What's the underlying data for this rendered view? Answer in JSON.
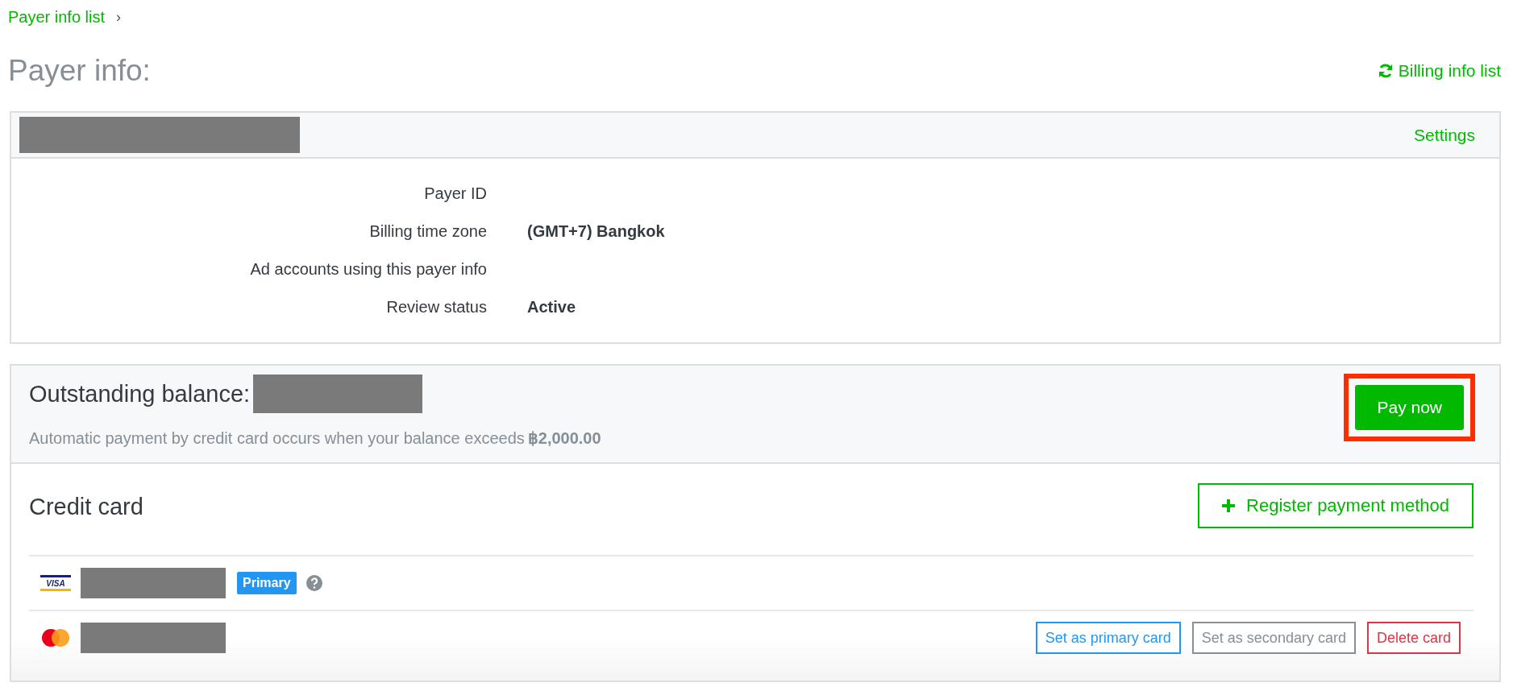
{
  "breadcrumb": {
    "link": "Payer info list",
    "separator": "›"
  },
  "page_title": "Payer info:",
  "billing_link": "Billing info list",
  "payer_panel": {
    "settings_link": "Settings",
    "rows": [
      {
        "label": "Payer ID"
      },
      {
        "label": "Billing time zone",
        "value": "(GMT+7) Bangkok"
      },
      {
        "label": "Ad accounts using this payer info"
      },
      {
        "label": "Review status",
        "value": "Active"
      }
    ]
  },
  "balance": {
    "heading": "Outstanding balance:",
    "note": "Automatic payment by credit card occurs when your balance exceeds",
    "threshold": "฿2,000.00",
    "pay_button": "Pay now",
    "pay_highlighted": true
  },
  "credit_cards": {
    "heading": "Credit card",
    "register_button": "Register payment method",
    "cards": [
      {
        "kind": "visa",
        "logo_text": "VISA",
        "badge": "Primary"
      },
      {
        "kind": "mastercard",
        "actions": [
          {
            "label": "Set as primary card",
            "kind": "primary"
          },
          {
            "label": "Set as secondary card",
            "kind": "secondary"
          },
          {
            "label": "Delete card",
            "kind": "danger"
          }
        ]
      }
    ]
  }
}
